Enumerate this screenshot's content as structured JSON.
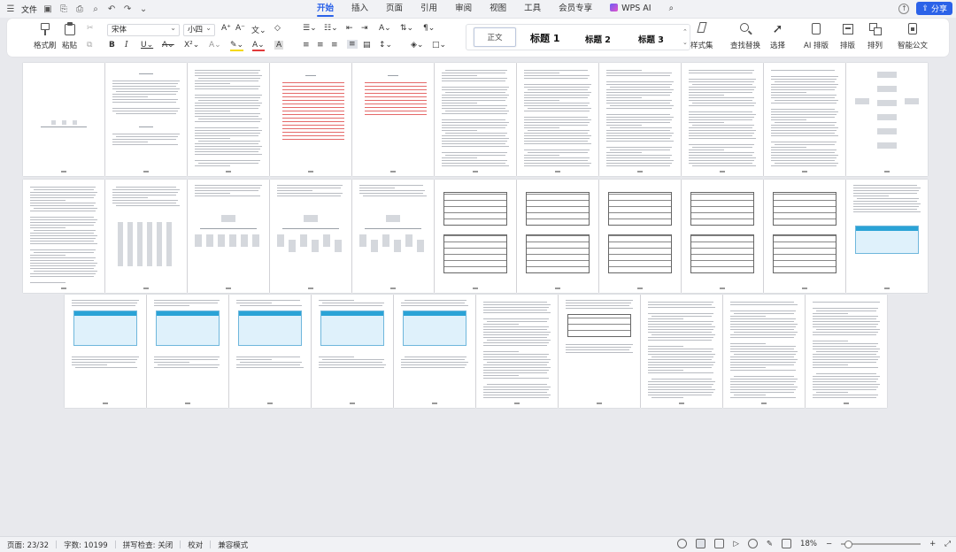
{
  "menubar": {
    "file_label": "文件",
    "tabs": [
      "开始",
      "插入",
      "页面",
      "引用",
      "审阅",
      "视图",
      "工具",
      "会员专享",
      "WPS AI"
    ],
    "active_tab": "开始",
    "share_label": "分享"
  },
  "ribbon": {
    "format_painter": "格式刷",
    "paste": "粘贴",
    "font_name": "宋体",
    "font_size": "小四",
    "styles": {
      "normal": "正文",
      "h1": "标题 1",
      "h2": "标题 2",
      "h3": "标题 3"
    },
    "style_set": "样式集",
    "find_replace": "查找替换",
    "select": "选择",
    "ai_layout": "AI 排版",
    "layout": "排版",
    "arrange": "排列",
    "smart_doc": "智能公文"
  },
  "status": {
    "page": "页面: 23/32",
    "words": "字数: 10199",
    "spell": "拼写检查: 关闭",
    "proof": "校对",
    "compat": "兼容模式",
    "zoom": "18%"
  },
  "colors": {
    "accent": "#2b62e8",
    "highlight": "#f5d90a",
    "font_color": "#e23b3b"
  }
}
